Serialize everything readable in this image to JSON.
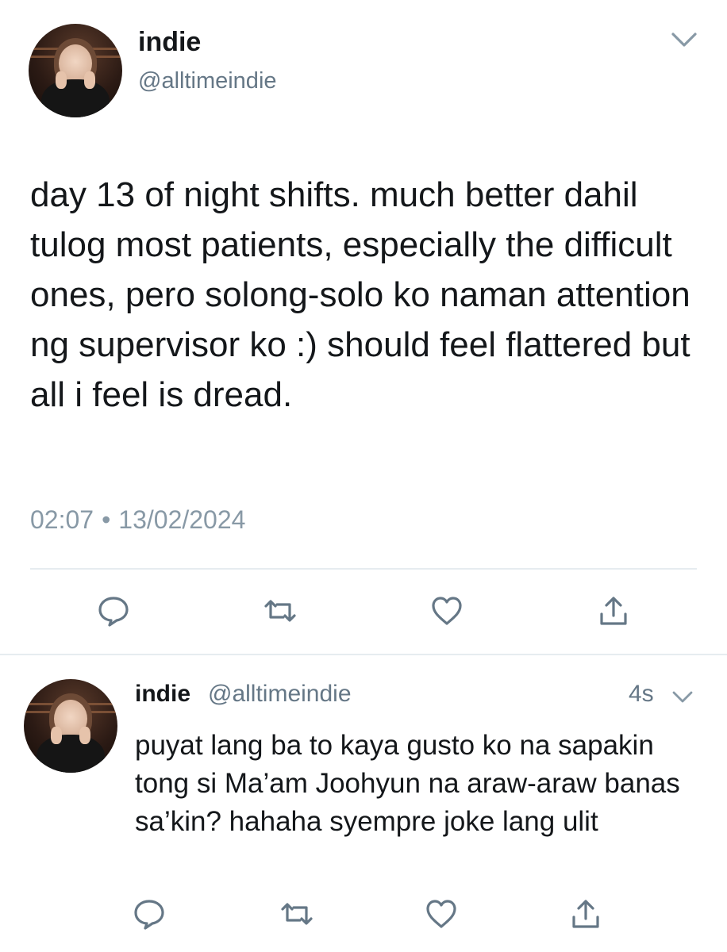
{
  "main_tweet": {
    "display_name": "indie",
    "handle": "@alltimeindie",
    "text": "day 13 of night shifts. much better dahil tulog most patients, especially the difficult ones, pero solong-solo ko naman attention ng supervisor ko :) should feel flattered but all i feel is dread.",
    "time": "02:07",
    "separator": "•",
    "date": "13/02/2024"
  },
  "reply_tweet": {
    "display_name": "indie",
    "handle": "@alltimeindie",
    "age": "4s",
    "text": "puyat lang ba to kaya gusto ko na sapakin tong si Ma’am Joohyun na araw-araw banas sa’kin? hahaha syempre joke lang ulit"
  },
  "icons": {
    "menu": "chevron-down-icon",
    "reply": "reply-icon",
    "retweet": "retweet-icon",
    "like": "heart-icon",
    "share": "share-icon"
  },
  "colors": {
    "text_primary": "#14171a",
    "text_secondary": "#657786",
    "icon_gray": "#657786",
    "divider": "#e6ecf0"
  }
}
